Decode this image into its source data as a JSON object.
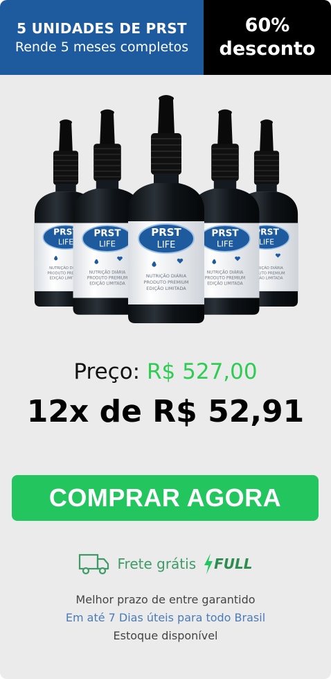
{
  "header": {
    "title": "5 UNIDADES DE PRST",
    "subtitle": "Rende 5 meses completos",
    "discount_line1": "60%",
    "discount_line2": "desconto"
  },
  "product": {
    "brand": "PRST LIFE",
    "label_lines": [
      "NUTRIÇÃO DIÁRIA",
      "PRODUTO PREMIUM",
      "EDIÇÃO LIMITADA"
    ],
    "bottle_count": 5
  },
  "price": {
    "label": "Preço:",
    "value": "R$ 527,00",
    "installments": "12x de R$ 52,91"
  },
  "buy_button": {
    "label": "COMPRAR AGORA"
  },
  "shipping": {
    "text": "Frete grátis",
    "full": "FULL",
    "icon": "truck-icon"
  },
  "info": {
    "line1": "Melhor prazo de entre garantido",
    "line2": "Em até 7 Dias úteis para todo Brasil",
    "line3": "Estoque disponível"
  },
  "colors": {
    "header_blue": "#1d5a9e",
    "header_black": "#000000",
    "background": "#ebebeb",
    "price_green": "#2ecc52",
    "button_green": "#22c55e",
    "shipping_green": "#3f9b66",
    "link_blue": "#4a7bb8"
  }
}
